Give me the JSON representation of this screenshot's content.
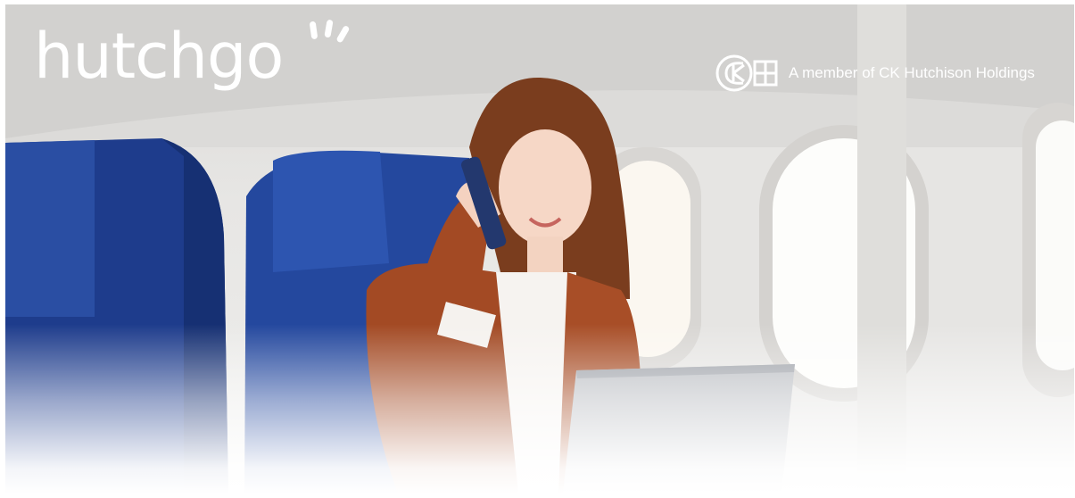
{
  "brand": {
    "logo_text": "hutchgo",
    "logo_color": "#ffffff"
  },
  "member_badge": {
    "text": "A member of CK Hutchison Holdings",
    "logo_text": "CKH"
  },
  "photo": {
    "seat_color": "#1f3f8f",
    "jacket_color": "#a84a24"
  }
}
